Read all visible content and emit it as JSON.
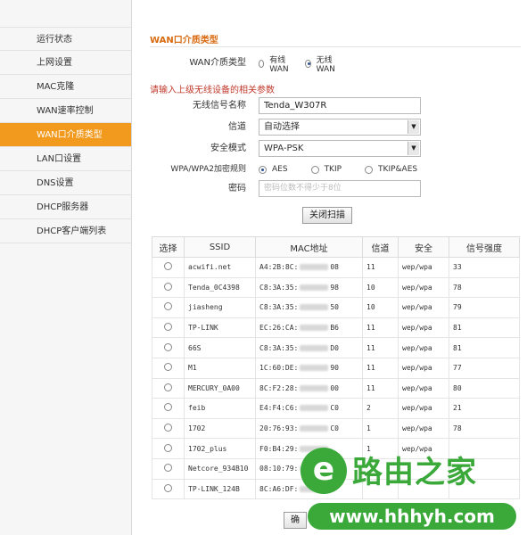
{
  "sidebar": {
    "items": [
      {
        "label": "运行状态",
        "active": false
      },
      {
        "label": "上网设置",
        "active": false
      },
      {
        "label": "MAC克隆",
        "active": false
      },
      {
        "label": "WAN速率控制",
        "active": false
      },
      {
        "label": "WAN口介质类型",
        "active": true
      },
      {
        "label": "LAN口设置",
        "active": false
      },
      {
        "label": "DNS设置",
        "active": false
      },
      {
        "label": "DHCP服务器",
        "active": false
      },
      {
        "label": "DHCP客户端列表",
        "active": false
      }
    ]
  },
  "section": {
    "title": "WAN口介质类型",
    "wan_media_label": "WAN介质类型",
    "wan_media_options": [
      "有线WAN",
      "无线WAN"
    ],
    "wan_media_selected": "无线WAN",
    "notice": "请输入上级无线设备的相关参数"
  },
  "form": {
    "ssid_label": "无线信号名称",
    "ssid_value": "Tenda_W307R",
    "channel_label": "信道",
    "channel_value": "自动选择",
    "security_label": "安全模式",
    "security_value": "WPA-PSK",
    "cipher_label": "WPA/WPA2加密规则",
    "cipher_options": [
      "AES",
      "TKIP",
      "TKIP&AES"
    ],
    "cipher_selected": "AES",
    "password_label": "密码",
    "password_placeholder": "密码位数不得少于8位",
    "scan_button": "关闭扫描",
    "confirm_button": "确"
  },
  "table": {
    "headers": [
      "选择",
      "SSID",
      "MAC地址",
      "信道",
      "安全",
      "信号强度"
    ],
    "rows": [
      {
        "ssid": "acwifi.net",
        "mac_start": "A4:2B:8C:",
        "mac_end": "08",
        "channel": "11",
        "security": "wep/wpa",
        "signal": "33"
      },
      {
        "ssid": "Tenda_0C4398",
        "mac_start": "C8:3A:35:",
        "mac_end": "98",
        "channel": "10",
        "security": "wep/wpa",
        "signal": "78"
      },
      {
        "ssid": "jiasheng",
        "mac_start": "C8:3A:35:",
        "mac_end": "50",
        "channel": "10",
        "security": "wep/wpa",
        "signal": "79"
      },
      {
        "ssid": "TP-LINK",
        "mac_start": "EC:26:CA:",
        "mac_end": "B6",
        "channel": "11",
        "security": "wep/wpa",
        "signal": "81"
      },
      {
        "ssid": "66S",
        "mac_start": "C8:3A:35:",
        "mac_end": "D0",
        "channel": "11",
        "security": "wep/wpa",
        "signal": "81"
      },
      {
        "ssid": "M1",
        "mac_start": "1C:60:DE:",
        "mac_end": "90",
        "channel": "11",
        "security": "wep/wpa",
        "signal": "77"
      },
      {
        "ssid": "MERCURY_0A00",
        "mac_start": "8C:F2:28:",
        "mac_end": "00",
        "channel": "11",
        "security": "wep/wpa",
        "signal": "80"
      },
      {
        "ssid": "feib",
        "mac_start": "E4:F4:C6:",
        "mac_end": "C0",
        "channel": "2",
        "security": "wep/wpa",
        "signal": "21"
      },
      {
        "ssid": "1702",
        "mac_start": "20:76:93:",
        "mac_end": "C0",
        "channel": "1",
        "security": "wep/wpa",
        "signal": "78"
      },
      {
        "ssid": "1702_plus",
        "mac_start": "F0:B4:29:",
        "mac_end": "",
        "channel": "1",
        "security": "wep/wpa",
        "signal": ""
      },
      {
        "ssid": "Netcore_934B10",
        "mac_start": "08:10:79:",
        "mac_end": "",
        "channel": "",
        "security": "",
        "signal": ""
      },
      {
        "ssid": "TP-LINK_124B",
        "mac_start": "8C:A6:DF:",
        "mac_end": "",
        "channel": "",
        "security": "",
        "signal": ""
      }
    ]
  },
  "watermark": {
    "logo_char": "e",
    "title": "路由之家",
    "url": "www.hhhyh.com",
    "color": "#3aa93a"
  },
  "colors": {
    "accent": "#f19a1e",
    "section_title": "#d86a10",
    "notice": "#c0392b"
  }
}
